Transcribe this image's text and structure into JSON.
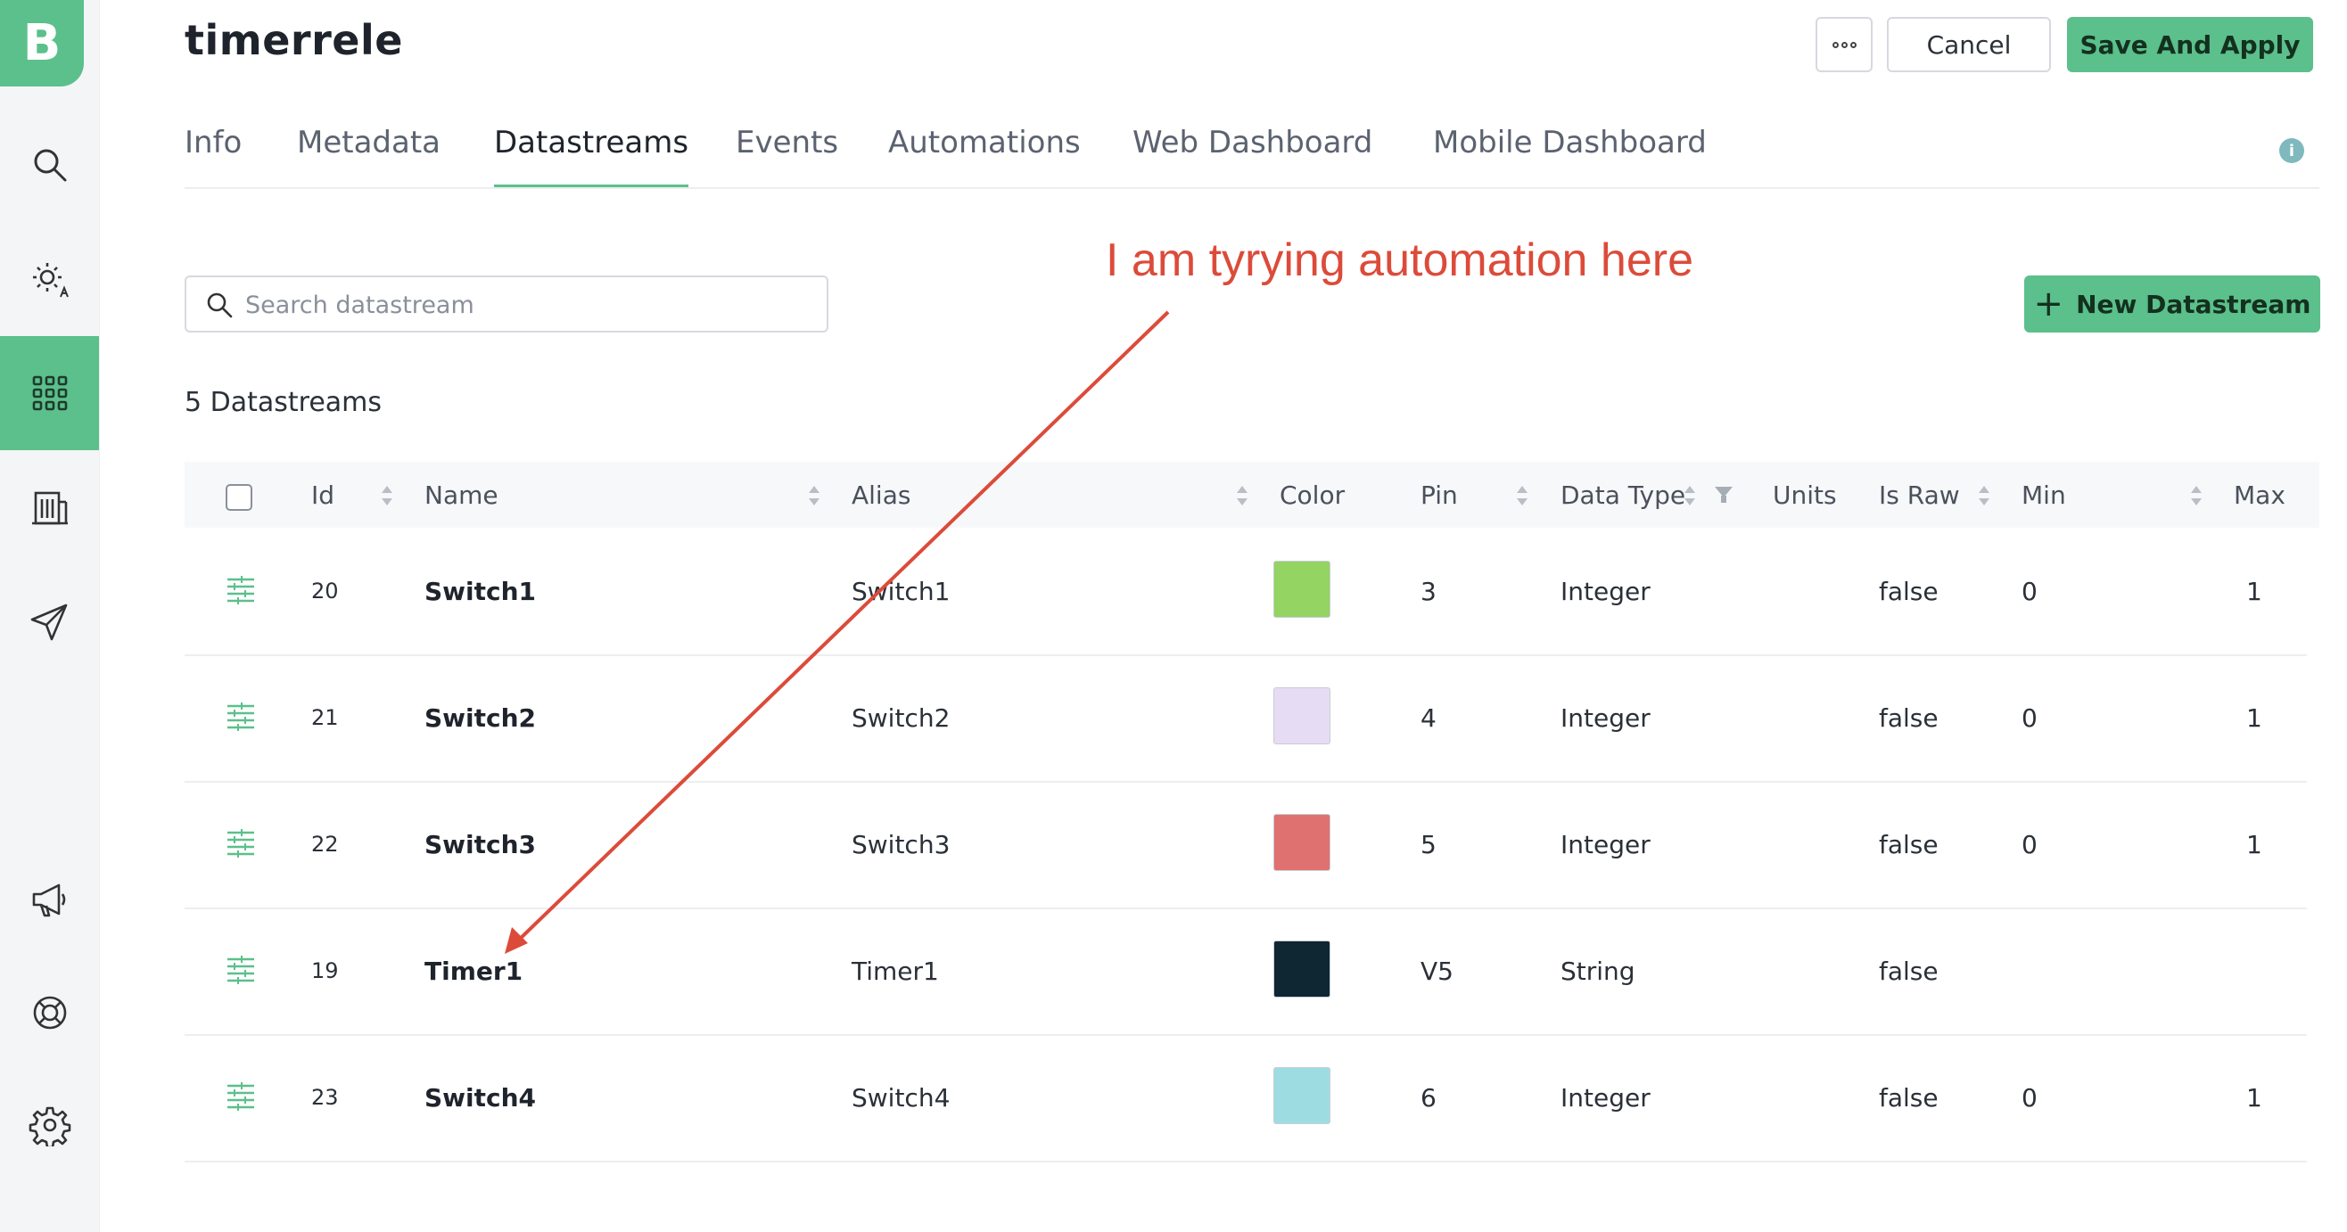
{
  "app": {
    "logo_letter": "B",
    "brand_color": "#5bc08b"
  },
  "header": {
    "title": "timerrele",
    "cancel_label": "Cancel",
    "save_label": "Save And Apply"
  },
  "tabs": [
    {
      "label": "Info"
    },
    {
      "label": "Metadata"
    },
    {
      "label": "Datastreams",
      "active": true
    },
    {
      "label": "Events"
    },
    {
      "label": "Automations"
    },
    {
      "label": "Web Dashboard"
    },
    {
      "label": "Mobile Dashboard"
    }
  ],
  "sidebar": {
    "items": [
      {
        "icon": "search-icon"
      },
      {
        "icon": "sun-automation-icon"
      },
      {
        "icon": "grid-icon",
        "active": true
      },
      {
        "icon": "building-icon"
      },
      {
        "icon": "send-icon"
      },
      {
        "icon": "megaphone-icon"
      },
      {
        "icon": "lifebuoy-icon"
      },
      {
        "icon": "gear-icon"
      }
    ]
  },
  "search": {
    "placeholder": "Search datastream",
    "value": ""
  },
  "new_button_label": "New Datastream",
  "count_label": "5 Datastreams",
  "annotation_text": "I am tyrying automation here",
  "annotation_color": "#dc4b3a",
  "table": {
    "columns": [
      "Id",
      "Name",
      "Alias",
      "Color",
      "Pin",
      "Data Type",
      "Units",
      "Is Raw",
      "Min",
      "Max"
    ],
    "rows": [
      {
        "id": "20",
        "name": "Switch1",
        "alias": "Switch1",
        "color": "#93d462",
        "pin": "3",
        "data_type": "Integer",
        "units": "",
        "is_raw": "false",
        "min": "0",
        "max": "1"
      },
      {
        "id": "21",
        "name": "Switch2",
        "alias": "Switch2",
        "color": "#e6dcf3",
        "pin": "4",
        "data_type": "Integer",
        "units": "",
        "is_raw": "false",
        "min": "0",
        "max": "1"
      },
      {
        "id": "22",
        "name": "Switch3",
        "alias": "Switch3",
        "color": "#e07171",
        "pin": "5",
        "data_type": "Integer",
        "units": "",
        "is_raw": "false",
        "min": "0",
        "max": "1"
      },
      {
        "id": "19",
        "name": "Timer1",
        "alias": "Timer1",
        "color": "#0f2633",
        "pin": "V5",
        "data_type": "String",
        "units": "",
        "is_raw": "false",
        "min": "",
        "max": ""
      },
      {
        "id": "23",
        "name": "Switch4",
        "alias": "Switch4",
        "color": "#9ddde2",
        "pin": "6",
        "data_type": "Integer",
        "units": "",
        "is_raw": "false",
        "min": "0",
        "max": "1"
      }
    ]
  }
}
